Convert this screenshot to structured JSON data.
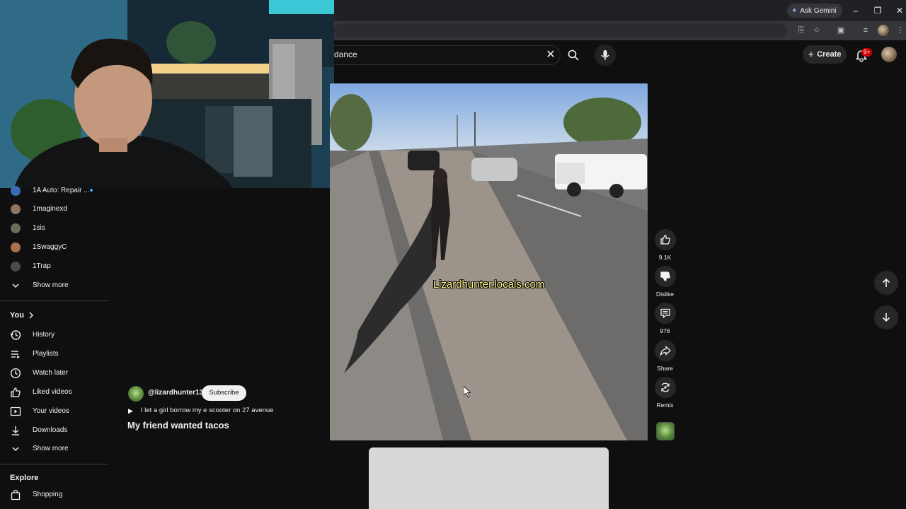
{
  "browser": {
    "gemini_label": "Ask Gemini"
  },
  "header": {
    "search_value": "dance",
    "create_label": "Create",
    "notification_count": "9+"
  },
  "sidebar": {
    "subscriptions": [
      {
        "label": "1A Auto: Repair ..."
      },
      {
        "label": "1maginexd"
      },
      {
        "label": "1sis"
      },
      {
        "label": "1SwaggyC"
      },
      {
        "label": "1Trap"
      },
      {
        "label": "Show more"
      }
    ],
    "you_heading": "You",
    "you_items": [
      {
        "label": "History"
      },
      {
        "label": "Playlists"
      },
      {
        "label": "Watch later"
      },
      {
        "label": "Liked videos"
      },
      {
        "label": "Your videos"
      },
      {
        "label": "Downloads"
      },
      {
        "label": "Show more"
      }
    ],
    "explore_heading": "Explore",
    "explore_items": [
      {
        "label": "Shopping"
      }
    ]
  },
  "video": {
    "watermark": "Lizardhunter.locals.com",
    "channel_handle": "@lizardhunter13",
    "subscribe_label": "Subscribe",
    "suggested_text": "I let a girl borrow my e scooter on 27 avenue",
    "title": "My friend wanted tacos"
  },
  "actions": {
    "likes": "9.1K",
    "dislike_label": "Dislike",
    "comments": "976",
    "share_label": "Share",
    "remix_label": "Remix"
  }
}
